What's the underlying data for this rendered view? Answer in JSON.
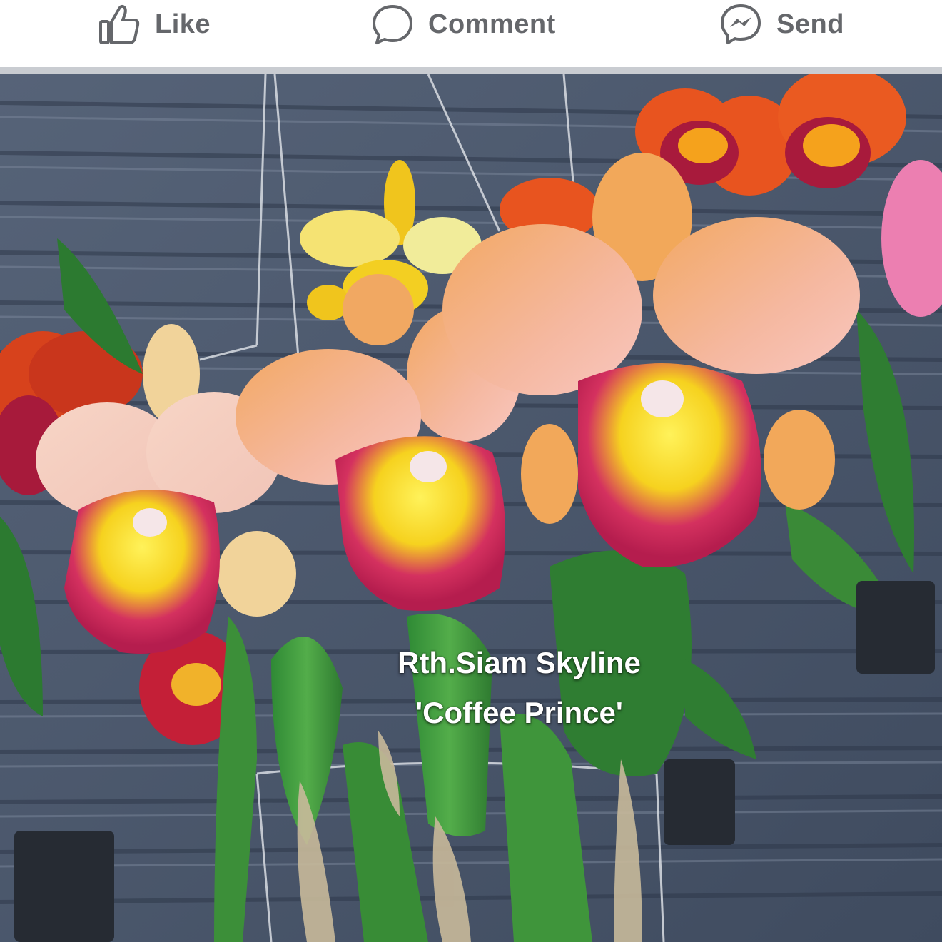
{
  "actions": {
    "like_label": "Like",
    "comment_label": "Comment",
    "send_label": "Send"
  },
  "icons": {
    "like": "thumbs-up-icon",
    "comment": "speech-bubble-icon",
    "send": "messenger-icon"
  },
  "photo": {
    "caption_line1": "Rth.Siam Skyline",
    "caption_line2": "'Coffee Prince'"
  },
  "colors": {
    "action_text": "#65676b",
    "divider": "#c9ccd1",
    "background": "#ffffff"
  }
}
